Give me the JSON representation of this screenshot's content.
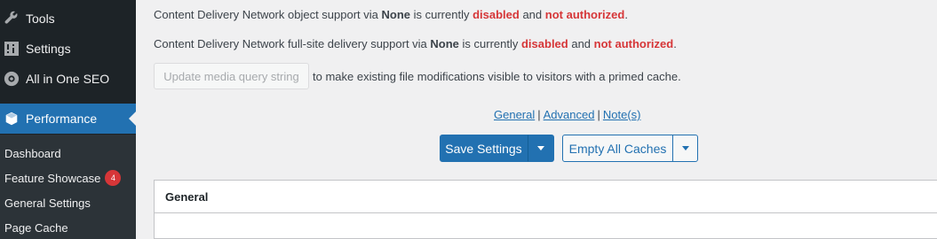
{
  "sidebar": {
    "menu": [
      {
        "label": "Tools",
        "icon": "wrench-icon"
      },
      {
        "label": "Settings",
        "icon": "settings-sliders-icon"
      },
      {
        "label": "All in One SEO",
        "icon": "aioseo-gear-icon"
      },
      {
        "label": "Performance",
        "icon": "performance-cube-icon",
        "current": true
      }
    ],
    "submenu": [
      {
        "label": "Dashboard"
      },
      {
        "label": "Feature Showcase",
        "badge": "4"
      },
      {
        "label": "General Settings"
      },
      {
        "label": "Page Cache"
      }
    ]
  },
  "cdn": {
    "object_line": {
      "prefix": "Content Delivery Network object support via ",
      "provider": "None",
      "mid": " is currently ",
      "status": "disabled",
      "and": " and ",
      "auth": "not authorized",
      "end": "."
    },
    "fullsite_line": {
      "prefix": "Content Delivery Network full-site delivery support via ",
      "provider": "None",
      "mid": " is currently ",
      "status": "disabled",
      "and": " and ",
      "auth": "not authorized",
      "end": "."
    }
  },
  "media_query": {
    "button_label": "Update media query string",
    "description": "to make existing file modifications visible to visitors with a primed cache."
  },
  "section_links": {
    "general": "General",
    "advanced": "Advanced",
    "notes": "Note(s)",
    "separator": "|"
  },
  "actions": {
    "save_label": "Save Settings",
    "empty_label": "Empty All Caches"
  },
  "panel": {
    "title": "General"
  },
  "colors": {
    "accent": "#2271b1",
    "warning": "#d63638",
    "sidebar_bg": "#1d2327",
    "submenu_bg": "#2c3338"
  }
}
